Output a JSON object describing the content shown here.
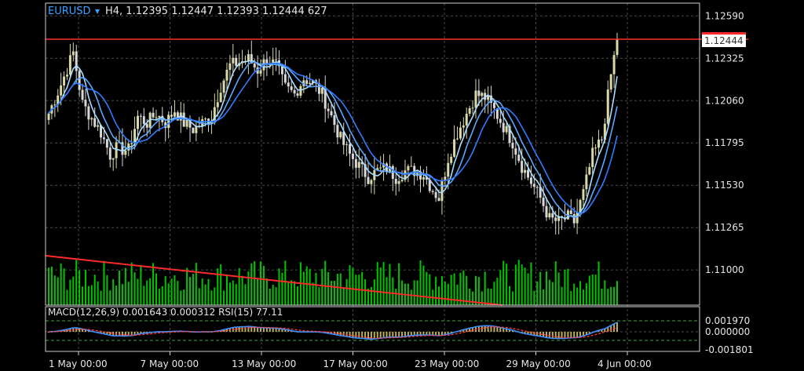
{
  "header": {
    "symbol": "EURUSD",
    "arrow": "▾",
    "info": "H4, 1.12395 1.12447 1.12393 1.12444 627"
  },
  "subheader": {
    "text": "MACD(12,26,9) 0.001643 0.000312 RSI(15) 77.11"
  },
  "colors": {
    "background": "#000000",
    "grid": "#4a4a4a",
    "axis_text": "#e6e6e6",
    "bull_candle": "#d9d9a6",
    "bear_candle": "#d8d8d8",
    "ma_fast": "#a9dcff",
    "ma_mid": "#5aa8ff",
    "ma_slow": "#2f7cff",
    "volume": "#00c400",
    "trend_line": "#ff2a2a",
    "price_line": "#ff2a2a",
    "symbol_blue": "#3fa0ff",
    "macd_signal": "#ff3b3b",
    "macd_main": "#3f8fff",
    "macd_hist": "#bcae5a",
    "level_line": "#3aa63a"
  },
  "chart_data": {
    "type": "candlestick",
    "timeframe": "H4",
    "y_ticks": [
      1.1259,
      1.12325,
      1.1206,
      1.11795,
      1.1153,
      1.11265,
      1.11
    ],
    "y_tick_labels": [
      "1.12590",
      "1.12325",
      "1.12060",
      "1.11795",
      "1.11530",
      "1.11265",
      "1.11000"
    ],
    "ylim": [
      1.1078,
      1.1267
    ],
    "current_price": 1.12444,
    "current_price_label": "1.12444",
    "x_tick_labels": [
      "1 May 00:00",
      "7 May 00:00",
      "13 May 00:00",
      "17 May 00:00",
      "23 May 00:00",
      "29 May 00:00",
      "4 Jun 00:00"
    ],
    "close_anchors": [
      [
        0,
        1.1198
      ],
      [
        4,
        1.1216
      ],
      [
        8,
        1.1236
      ],
      [
        11,
        1.1204
      ],
      [
        14,
        1.1195
      ],
      [
        17,
        1.1186
      ],
      [
        20,
        1.1172
      ],
      [
        22,
        1.1176
      ],
      [
        26,
        1.1175
      ],
      [
        29,
        1.1196
      ],
      [
        32,
        1.1192
      ],
      [
        35,
        1.1198
      ],
      [
        38,
        1.1192
      ],
      [
        41,
        1.12
      ],
      [
        44,
        1.1192
      ],
      [
        47,
        1.1188
      ],
      [
        50,
        1.1192
      ],
      [
        53,
        1.1196
      ],
      [
        56,
        1.1215
      ],
      [
        59,
        1.1228
      ],
      [
        62,
        1.123
      ],
      [
        65,
        1.1232
      ],
      [
        68,
        1.1225
      ],
      [
        71,
        1.1232
      ],
      [
        74,
        1.1228
      ],
      [
        77,
        1.1214
      ],
      [
        80,
        1.121
      ],
      [
        83,
        1.122
      ],
      [
        86,
        1.1217
      ],
      [
        89,
        1.121
      ],
      [
        92,
        1.1196
      ],
      [
        95,
        1.1182
      ],
      [
        98,
        1.1172
      ],
      [
        101,
        1.1165
      ],
      [
        104,
        1.1158
      ],
      [
        107,
        1.1162
      ],
      [
        110,
        1.1164
      ],
      [
        113,
        1.1158
      ],
      [
        116,
        1.1162
      ],
      [
        119,
        1.1162
      ],
      [
        122,
        1.116
      ],
      [
        125,
        1.115
      ],
      [
        127,
        1.1145
      ],
      [
        130,
        1.117
      ],
      [
        133,
        1.1186
      ],
      [
        136,
        1.1198
      ],
      [
        139,
        1.121
      ],
      [
        142,
        1.1208
      ],
      [
        145,
        1.12
      ],
      [
        148,
        1.119
      ],
      [
        151,
        1.118
      ],
      [
        154,
        1.1165
      ],
      [
        157,
        1.1155
      ],
      [
        160,
        1.1145
      ],
      [
        163,
        1.1132
      ],
      [
        166,
        1.113
      ],
      [
        169,
        1.1133
      ],
      [
        171,
        1.113
      ],
      [
        174,
        1.1148
      ],
      [
        177,
        1.1172
      ],
      [
        180,
        1.1182
      ],
      [
        183,
        1.1222
      ],
      [
        185,
        1.12444
      ]
    ],
    "volume_range": [
      0.3,
      1.0
    ],
    "volume_trendline": "descending",
    "subwindow": {
      "y_tick_labels": [
        "0.001970",
        "0.000000",
        "-0.001801"
      ],
      "macd_main_last": 0.001643,
      "macd_signal_last": 0.000312,
      "rsi_last": 77.11
    },
    "grid": true
  }
}
